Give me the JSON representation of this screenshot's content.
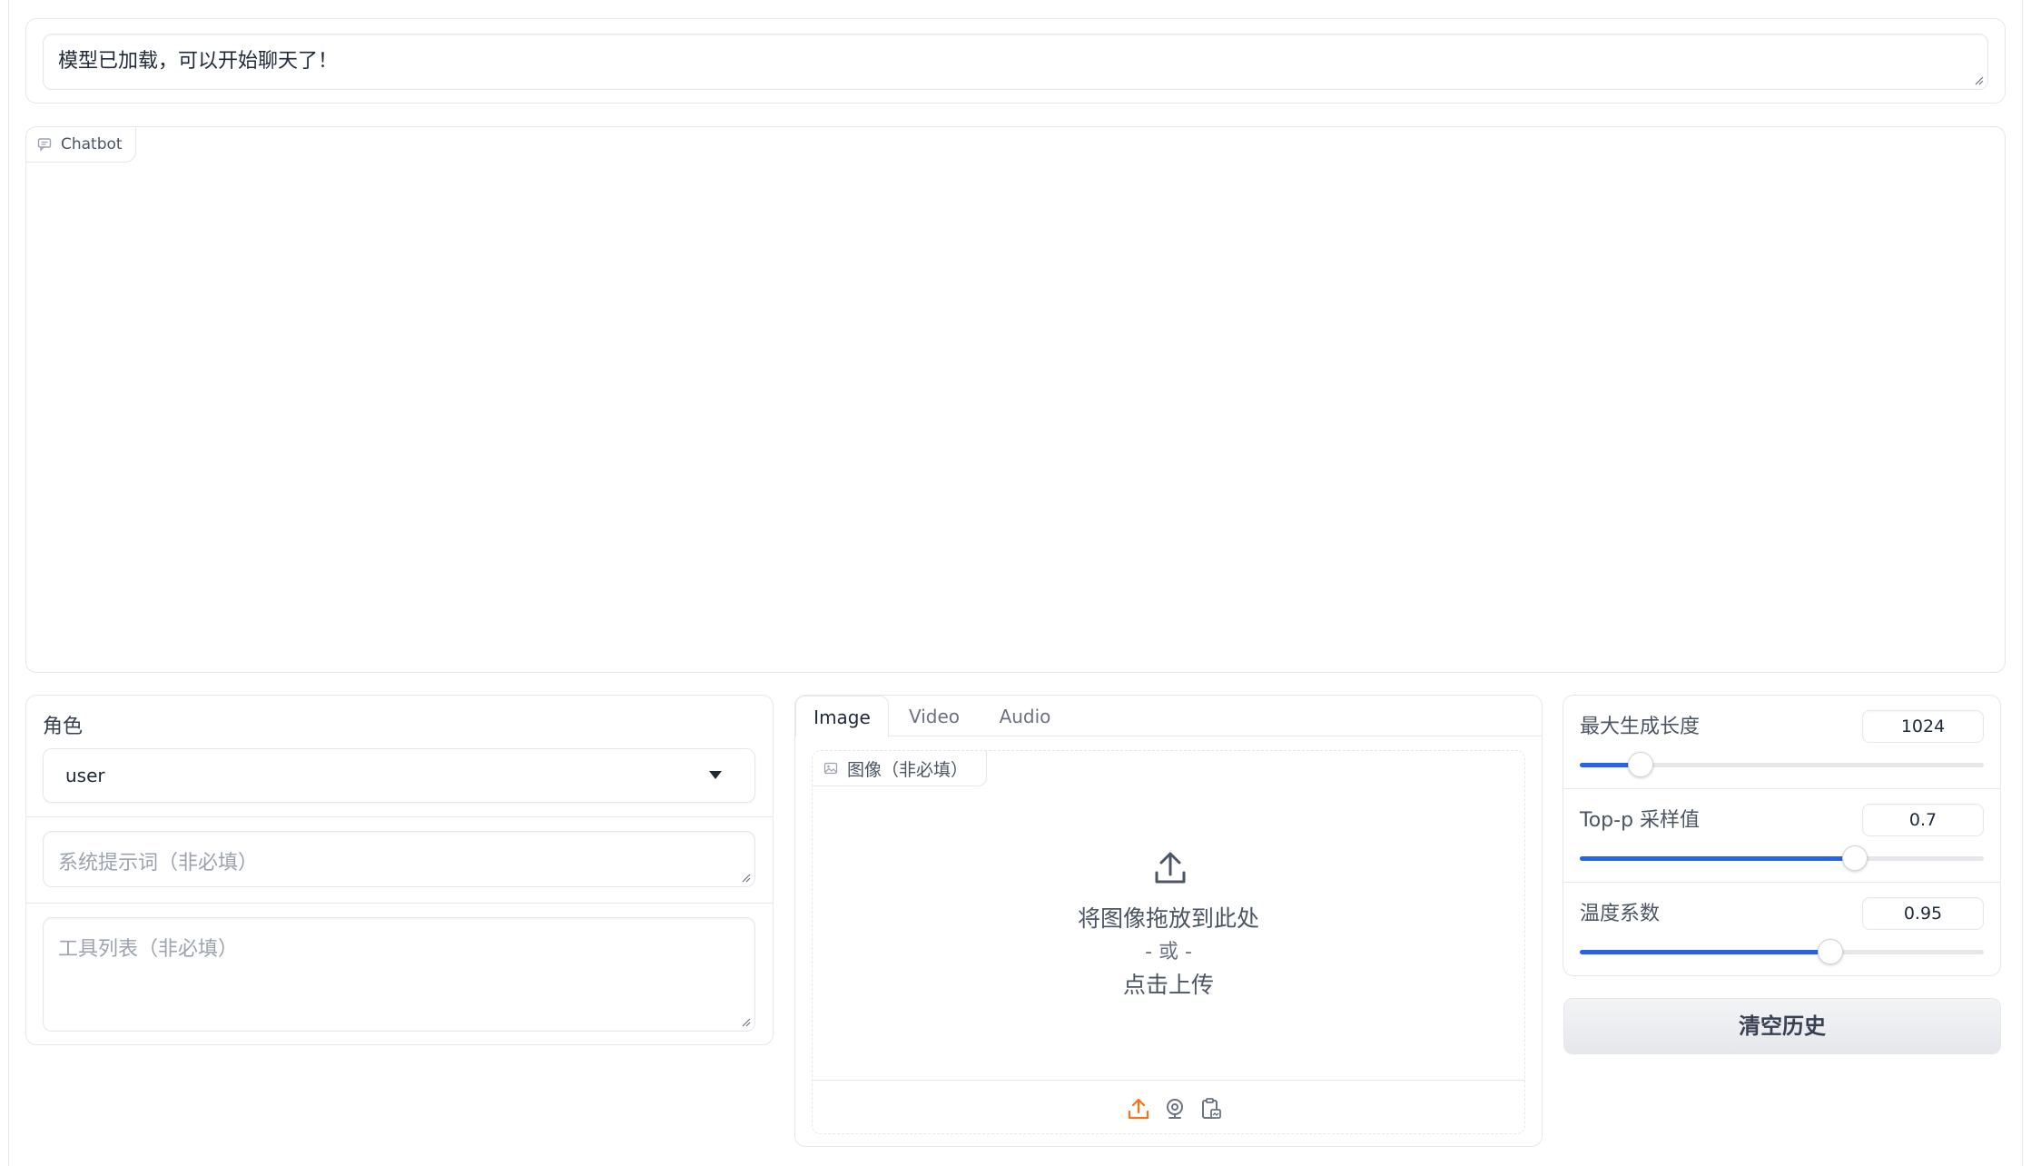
{
  "status": {
    "text": "模型已加载，可以开始聊天了！"
  },
  "chatbot": {
    "label": "Chatbot",
    "icon": "chat-icon"
  },
  "left_panel": {
    "role_label": "角色",
    "role_value": "user",
    "system_prompt_placeholder": "系统提示词（非必填）",
    "tools_placeholder": "工具列表（非必填）"
  },
  "media": {
    "tabs": [
      {
        "label": "Image",
        "active": true
      },
      {
        "label": "Video",
        "active": false
      },
      {
        "label": "Audio",
        "active": false
      }
    ],
    "image_label": "图像（非必填）",
    "drop_text": "将图像拖放到此处",
    "or_text": "- 或 -",
    "click_text": "点击上传",
    "source_icons": [
      "upload-icon",
      "webcam-icon",
      "clipboard-icon"
    ]
  },
  "params": {
    "sliders": [
      {
        "label": "最大生成长度",
        "value": "1024",
        "fraction": 0.15
      },
      {
        "label": "Top-p 采样值",
        "value": "0.7",
        "fraction": 0.68
      },
      {
        "label": "温度系数",
        "value": "0.95",
        "fraction": 0.62
      }
    ],
    "clear_label": "清空历史"
  },
  "colors": {
    "accent": "#2563eb",
    "upload_accent": "#f97316",
    "border": "#e5e7eb"
  }
}
